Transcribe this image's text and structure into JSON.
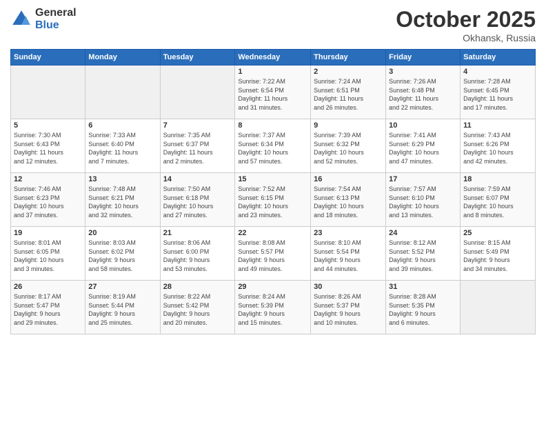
{
  "logo": {
    "general": "General",
    "blue": "Blue"
  },
  "header": {
    "title": "October 2025",
    "subtitle": "Okhansk, Russia"
  },
  "days_of_week": [
    "Sunday",
    "Monday",
    "Tuesday",
    "Wednesday",
    "Thursday",
    "Friday",
    "Saturday"
  ],
  "weeks": [
    [
      {
        "day": "",
        "info": ""
      },
      {
        "day": "",
        "info": ""
      },
      {
        "day": "",
        "info": ""
      },
      {
        "day": "1",
        "info": "Sunrise: 7:22 AM\nSunset: 6:54 PM\nDaylight: 11 hours\nand 31 minutes."
      },
      {
        "day": "2",
        "info": "Sunrise: 7:24 AM\nSunset: 6:51 PM\nDaylight: 11 hours\nand 26 minutes."
      },
      {
        "day": "3",
        "info": "Sunrise: 7:26 AM\nSunset: 6:48 PM\nDaylight: 11 hours\nand 22 minutes."
      },
      {
        "day": "4",
        "info": "Sunrise: 7:28 AM\nSunset: 6:45 PM\nDaylight: 11 hours\nand 17 minutes."
      }
    ],
    [
      {
        "day": "5",
        "info": "Sunrise: 7:30 AM\nSunset: 6:43 PM\nDaylight: 11 hours\nand 12 minutes."
      },
      {
        "day": "6",
        "info": "Sunrise: 7:33 AM\nSunset: 6:40 PM\nDaylight: 11 hours\nand 7 minutes."
      },
      {
        "day": "7",
        "info": "Sunrise: 7:35 AM\nSunset: 6:37 PM\nDaylight: 11 hours\nand 2 minutes."
      },
      {
        "day": "8",
        "info": "Sunrise: 7:37 AM\nSunset: 6:34 PM\nDaylight: 10 hours\nand 57 minutes."
      },
      {
        "day": "9",
        "info": "Sunrise: 7:39 AM\nSunset: 6:32 PM\nDaylight: 10 hours\nand 52 minutes."
      },
      {
        "day": "10",
        "info": "Sunrise: 7:41 AM\nSunset: 6:29 PM\nDaylight: 10 hours\nand 47 minutes."
      },
      {
        "day": "11",
        "info": "Sunrise: 7:43 AM\nSunset: 6:26 PM\nDaylight: 10 hours\nand 42 minutes."
      }
    ],
    [
      {
        "day": "12",
        "info": "Sunrise: 7:46 AM\nSunset: 6:23 PM\nDaylight: 10 hours\nand 37 minutes."
      },
      {
        "day": "13",
        "info": "Sunrise: 7:48 AM\nSunset: 6:21 PM\nDaylight: 10 hours\nand 32 minutes."
      },
      {
        "day": "14",
        "info": "Sunrise: 7:50 AM\nSunset: 6:18 PM\nDaylight: 10 hours\nand 27 minutes."
      },
      {
        "day": "15",
        "info": "Sunrise: 7:52 AM\nSunset: 6:15 PM\nDaylight: 10 hours\nand 23 minutes."
      },
      {
        "day": "16",
        "info": "Sunrise: 7:54 AM\nSunset: 6:13 PM\nDaylight: 10 hours\nand 18 minutes."
      },
      {
        "day": "17",
        "info": "Sunrise: 7:57 AM\nSunset: 6:10 PM\nDaylight: 10 hours\nand 13 minutes."
      },
      {
        "day": "18",
        "info": "Sunrise: 7:59 AM\nSunset: 6:07 PM\nDaylight: 10 hours\nand 8 minutes."
      }
    ],
    [
      {
        "day": "19",
        "info": "Sunrise: 8:01 AM\nSunset: 6:05 PM\nDaylight: 10 hours\nand 3 minutes."
      },
      {
        "day": "20",
        "info": "Sunrise: 8:03 AM\nSunset: 6:02 PM\nDaylight: 9 hours\nand 58 minutes."
      },
      {
        "day": "21",
        "info": "Sunrise: 8:06 AM\nSunset: 6:00 PM\nDaylight: 9 hours\nand 53 minutes."
      },
      {
        "day": "22",
        "info": "Sunrise: 8:08 AM\nSunset: 5:57 PM\nDaylight: 9 hours\nand 49 minutes."
      },
      {
        "day": "23",
        "info": "Sunrise: 8:10 AM\nSunset: 5:54 PM\nDaylight: 9 hours\nand 44 minutes."
      },
      {
        "day": "24",
        "info": "Sunrise: 8:12 AM\nSunset: 5:52 PM\nDaylight: 9 hours\nand 39 minutes."
      },
      {
        "day": "25",
        "info": "Sunrise: 8:15 AM\nSunset: 5:49 PM\nDaylight: 9 hours\nand 34 minutes."
      }
    ],
    [
      {
        "day": "26",
        "info": "Sunrise: 8:17 AM\nSunset: 5:47 PM\nDaylight: 9 hours\nand 29 minutes."
      },
      {
        "day": "27",
        "info": "Sunrise: 8:19 AM\nSunset: 5:44 PM\nDaylight: 9 hours\nand 25 minutes."
      },
      {
        "day": "28",
        "info": "Sunrise: 8:22 AM\nSunset: 5:42 PM\nDaylight: 9 hours\nand 20 minutes."
      },
      {
        "day": "29",
        "info": "Sunrise: 8:24 AM\nSunset: 5:39 PM\nDaylight: 9 hours\nand 15 minutes."
      },
      {
        "day": "30",
        "info": "Sunrise: 8:26 AM\nSunset: 5:37 PM\nDaylight: 9 hours\nand 10 minutes."
      },
      {
        "day": "31",
        "info": "Sunrise: 8:28 AM\nSunset: 5:35 PM\nDaylight: 9 hours\nand 6 minutes."
      },
      {
        "day": "",
        "info": ""
      }
    ]
  ]
}
